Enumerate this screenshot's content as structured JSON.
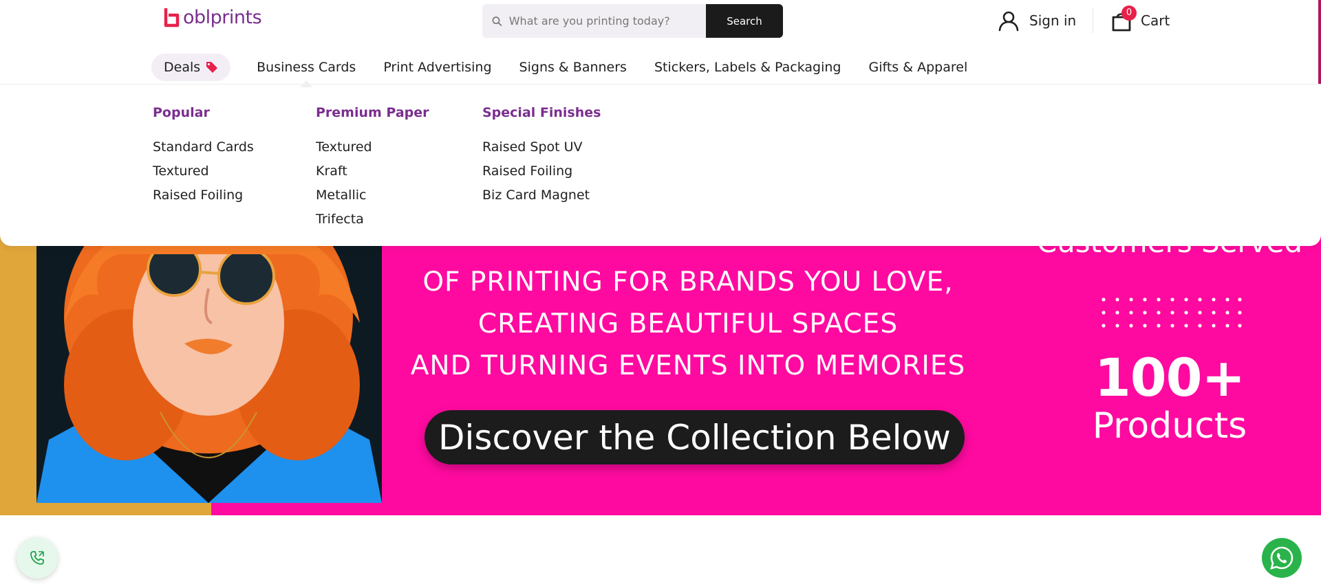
{
  "brand": {
    "name": "oblprints",
    "primary_color": "#7a2e8e",
    "accent_color": "#e8204a",
    "hero_color": "#ff0aa0"
  },
  "search": {
    "placeholder": "What are you printing today?",
    "button_label": "Search"
  },
  "account": {
    "label": "Sign in",
    "icon": "user-icon"
  },
  "cart": {
    "label": "Cart",
    "count": "0",
    "icon": "shopping-bag-icon"
  },
  "nav": {
    "deals_label": "Deals",
    "items": [
      "Business Cards",
      "Print Advertising",
      "Signs & Banners",
      "Stickers, Labels & Packaging",
      "Gifts & Apparel"
    ],
    "active_item": "Business Cards"
  },
  "dropdown": {
    "columns": [
      {
        "title": "Popular",
        "links": [
          "Standard Cards",
          "Textured",
          "Raised Foiling"
        ]
      },
      {
        "title": "Premium Paper",
        "links": [
          "Textured",
          "Kraft",
          "Metallic",
          "Trifecta"
        ]
      },
      {
        "title": "Special Finishes",
        "links": [
          "Raised Spot UV",
          "Raised Foiling",
          "Biz Card Magnet"
        ]
      }
    ]
  },
  "hero": {
    "lines": [
      "OF PRINTING FOR BRANDS YOU LOVE,",
      "CREATING BEAUTIFUL SPACES",
      "AND TURNING EVENTS INTO MEMORIES"
    ],
    "cta_label": "Discover the Collection Below",
    "stat_top_label": "Customers Served",
    "stat_number": "100+",
    "stat_label": "Products"
  },
  "floating": {
    "call_icon": "phone-icon",
    "whatsapp_icon": "whatsapp-icon"
  }
}
